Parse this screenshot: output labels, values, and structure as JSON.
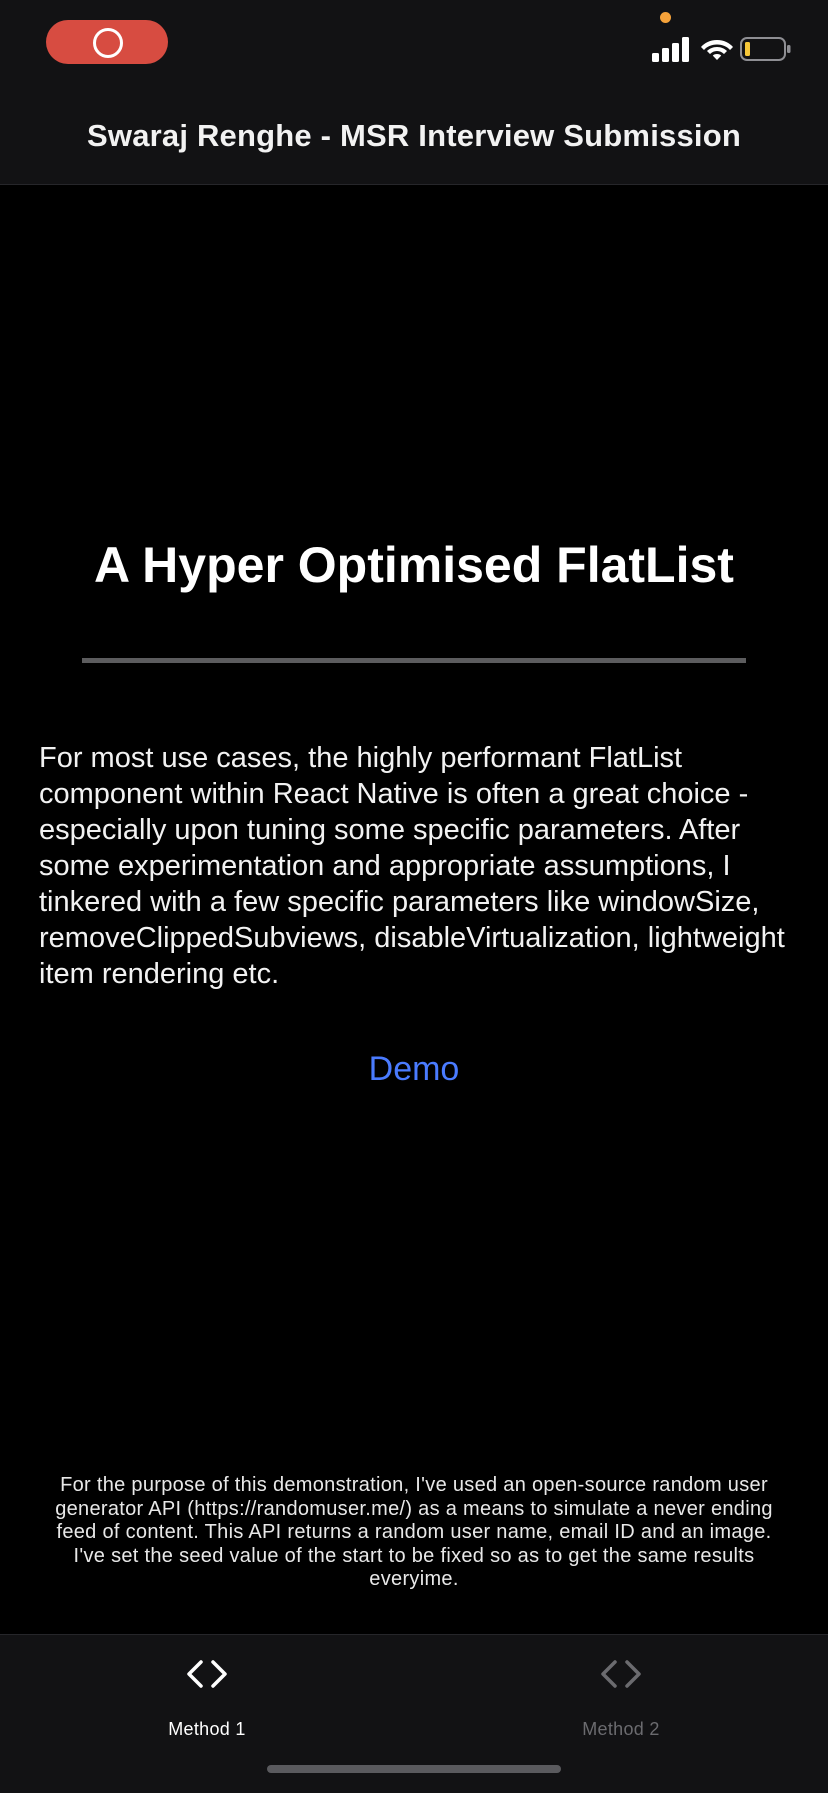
{
  "header": {
    "title": "Swaraj Renghe - MSR Interview Submission"
  },
  "status_bar": {
    "recording_icon": "screen-record-icon",
    "signal_icon": "cellular-signal-icon",
    "wifi_icon": "wifi-icon",
    "battery_icon": "battery-low-icon",
    "privacy_indicator_color": "#f5a23a",
    "recording_color": "#d74c41"
  },
  "main": {
    "title": "A Hyper Optimised FlatList",
    "description": "For most use cases, the highly performant FlatList component within React Native is often a great choice - especially upon tuning some specific parameters. After some experimentation and appropriate assumptions, I tinkered with a few specific parameters like windowSize, removeClippedSubviews, disableVirtualization, lightweight item rendering etc.",
    "demo_label": "Demo",
    "footnote": "For the purpose of this demonstration, I've used an open-source random user generator API (https://randomuser.me/) as a means to simulate a never ending feed of content. This API returns a random user name, email ID and an image. I've set the seed value of the start to be fixed so as to get the same results everyime."
  },
  "tabs": [
    {
      "label": "Method 1",
      "icon": "code-icon",
      "active": true
    },
    {
      "label": "Method 2",
      "icon": "code-icon",
      "active": false
    }
  ],
  "colors": {
    "accent": "#4a7bff",
    "tab_active": "#ffffff",
    "tab_inactive": "#6b6b6f"
  }
}
